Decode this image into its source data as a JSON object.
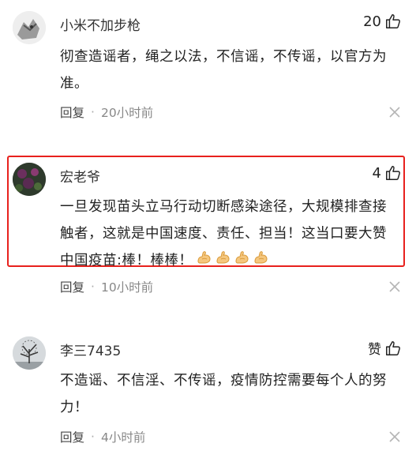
{
  "comments": [
    {
      "username": "小米不加步枪",
      "like_count": "20",
      "content": "彻查造谣者，绳之以法，不信谣，不传谣，以官方为准。",
      "reply_label": "回复",
      "time": "20小时前",
      "avatar_icon": "avatar-wolf-sketch"
    },
    {
      "username": "宏老爷",
      "like_count": "4",
      "content": "一旦发现苗头立马行动切断感染途径，大规模排查接触者，这就是中国速度、责任、担当！这当口要大赞中国疫苗:棒！棒棒！",
      "emoji_count": 4,
      "emoji_icon": "flexed-biceps-emoji",
      "reply_label": "回复",
      "time": "10小时前",
      "avatar_icon": "avatar-flowers",
      "highlighted": true,
      "highlight_color": "#e8211d"
    },
    {
      "username": "李三7435",
      "like_count": "赞",
      "content": "不造谣、不信淫、不传谣，疫情防控需要每个人的努力！",
      "reply_label": "回复",
      "time": "4小时前",
      "avatar_icon": "avatar-tree"
    }
  ],
  "icons": {
    "like": "thumbs-up-icon",
    "close": "close-icon"
  }
}
